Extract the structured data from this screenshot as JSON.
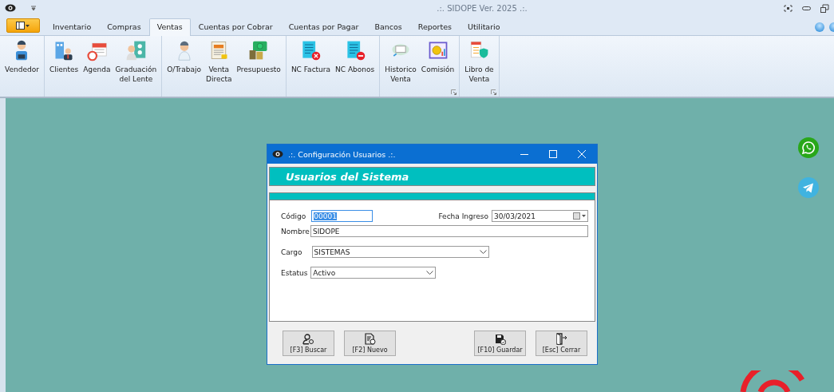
{
  "window": {
    "title": ".:. SIDOPE Ver. 2025 .:."
  },
  "tabs": [
    {
      "label": "Inventario",
      "selected": false
    },
    {
      "label": "Compras",
      "selected": false
    },
    {
      "label": "Ventas",
      "selected": true
    },
    {
      "label": "Cuentas por Cobrar",
      "selected": false
    },
    {
      "label": "Cuentas por Pagar",
      "selected": false
    },
    {
      "label": "Bancos",
      "selected": false
    },
    {
      "label": "Reportes",
      "selected": false
    },
    {
      "label": "Utilitario",
      "selected": false
    }
  ],
  "ribbon_groups": [
    {
      "launcher": false,
      "items": [
        {
          "label": "Vendedor"
        }
      ]
    },
    {
      "launcher": false,
      "items": [
        {
          "label": "Clientes"
        },
        {
          "label": "Agenda"
        },
        {
          "label": "Graduación\ndel Lente"
        }
      ]
    },
    {
      "launcher": false,
      "items": [
        {
          "label": "O/Trabajo"
        },
        {
          "label": "Venta\nDirecta"
        },
        {
          "label": "Presupuesto"
        }
      ]
    },
    {
      "launcher": false,
      "items": [
        {
          "label": "NC Factura"
        },
        {
          "label": "NC Abonos"
        }
      ]
    },
    {
      "launcher": true,
      "items": [
        {
          "label": "Historico\nVenta"
        },
        {
          "label": "Comisión"
        }
      ]
    },
    {
      "launcher": true,
      "items": [
        {
          "label": "Libro de\nVenta"
        }
      ]
    }
  ],
  "dialog": {
    "title": ".:. Configuración Usuarios .:.",
    "header": "Usuarios del Sistema",
    "fields": [
      {
        "label": "Código",
        "value": "00001",
        "kind": "text",
        "focused": true
      },
      {
        "label": "Fecha Ingreso",
        "value": "30/03/2021",
        "kind": "date",
        "focused": false
      },
      {
        "label": "Nombre",
        "value": "SIDOPE",
        "kind": "text",
        "focused": false
      },
      {
        "label": "Cargo",
        "value": "SISTEMAS",
        "kind": "combo",
        "focused": false
      },
      {
        "label": "Estatus",
        "value": "Activo",
        "kind": "combo",
        "focused": false
      }
    ],
    "buttons": [
      {
        "label": "[F3] Buscar"
      },
      {
        "label": "[F2] Nuevo"
      },
      {
        "label": "[F10] Guardar"
      },
      {
        "label": "[Esc] Cerrar"
      }
    ]
  }
}
